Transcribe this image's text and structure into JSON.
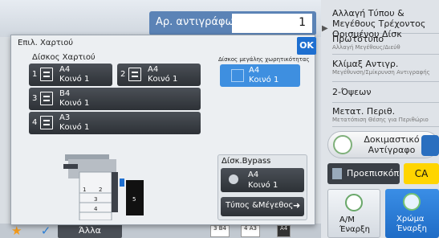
{
  "header": {
    "copies_label": "Αρ. αντιγράφων",
    "copies_value": "1"
  },
  "right_panel": {
    "items": [
      {
        "title": "Αλλαγή Τύπου & Μεγέθους Τρέχοντος Ορισμένου Δίσκ",
        "subtitle": ""
      },
      {
        "title": "Πρωτότυπο",
        "subtitle": "Αλλαγή Μεγέθους/Διεύθ"
      },
      {
        "title": "Κλίμαξ Αντιγρ.",
        "subtitle": "Μεγέθυνση/Σμίκρυνση Αντιγραφής"
      },
      {
        "title": "2-Όψεων",
        "subtitle": ""
      },
      {
        "title": "Μετατ. Περιθ.",
        "subtitle": "Μετατόπιση Θέσης για Περιθώριο"
      }
    ],
    "test_copy": "Δοκιμαστικό Αντίγραφο",
    "preview": "Προεπισκόπ",
    "ca": "CA",
    "bw_start": "Α/Μ Έναρξη",
    "color_start": "Χρώμα Έναρξη"
  },
  "bottom_bar": {
    "other": "Άλλα",
    "tray_rows": [
      {
        "num": "3",
        "size": "B4"
      },
      {
        "num": "4",
        "size": "A3"
      }
    ],
    "extra_size": "A4"
  },
  "dialog": {
    "title": "Επιλ. Χαρτιού",
    "ok": "OK",
    "trays_heading": "Δίσκος Χαρτιού",
    "trays": [
      {
        "num": "1",
        "size": "A4",
        "type": "Κοινό 1"
      },
      {
        "num": "2",
        "size": "A4",
        "type": "Κοινό 1"
      },
      {
        "num": "3",
        "size": "B4",
        "type": "Κοινό 1"
      },
      {
        "num": "4",
        "size": "A3",
        "type": "Κοινό 1"
      }
    ],
    "lct_heading": "Δίσκος μεγάλης χωρητικότητας",
    "lct": {
      "size": "A4",
      "type": "Κοινό 1"
    },
    "printer_labels": [
      "1",
      "2",
      "3",
      "4",
      "5"
    ],
    "bypass_heading": "Δίσκ.Bypass",
    "bypass": {
      "size": "A4",
      "type": "Κοινό 1"
    },
    "type_size_button": "Τύπος &Μέγεθος"
  },
  "colors": {
    "accent_blue": "#1e6fd0",
    "selected_tray": "#3e8fe0",
    "ca_yellow": "#ffd500",
    "dark_button": "#2d3136"
  }
}
